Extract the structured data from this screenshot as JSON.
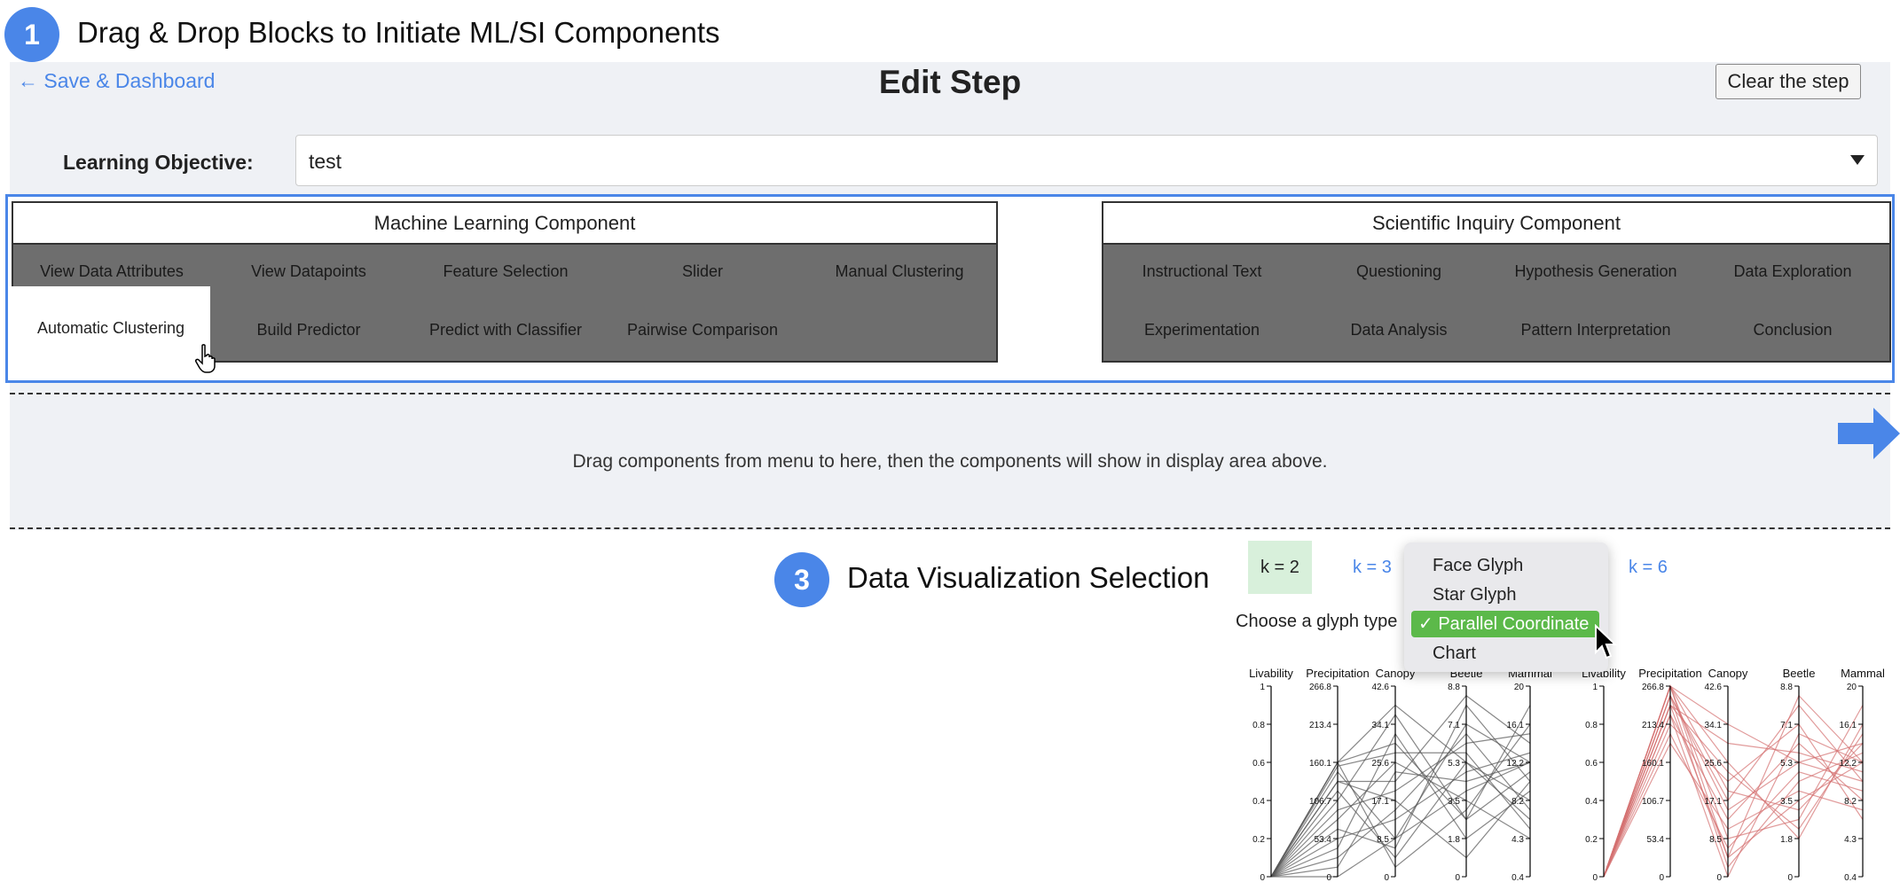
{
  "step1": {
    "number": "1",
    "title": "Drag & Drop Blocks to Initiate ML/SI Components"
  },
  "editor": {
    "back_link": "← Save & Dashboard",
    "title": "Edit Step",
    "clear_button": "Clear the step",
    "objective_label": "Learning Objective:",
    "objective_value": "test"
  },
  "ml_component": {
    "title": "Machine Learning Component",
    "blocks": [
      "View Data Attributes",
      "View Datapoints",
      "Feature Selection",
      "Slider",
      "Manual Clustering",
      "Automatic Clustering",
      "Build Predictor",
      "Predict with Classifier",
      "Pairwise Comparison"
    ],
    "selected": "Automatic Clustering"
  },
  "si_component": {
    "title": "Scientific Inquiry Component",
    "blocks": [
      "Instructional Text",
      "Questioning",
      "Hypothesis Generation",
      "Data Exploration",
      "Experimentation",
      "Data Analysis",
      "Pattern Interpretation",
      "Conclusion"
    ]
  },
  "drop_zone": {
    "text": "Drag components from menu to here, then the components will show in display area above."
  },
  "step3": {
    "number": "3",
    "title": "Data Visualization Selection"
  },
  "visualization": {
    "k_tabs": [
      "k = 2",
      "k = 3",
      "k = 6"
    ],
    "active_k": "k = 2",
    "glyph_label": "Choose a glyph type",
    "glyph_options": [
      "Face Glyph",
      "Star Glyph",
      "Parallel Coordinate",
      "Chart"
    ],
    "selected_glyph": "Parallel Coordinate",
    "check_mark": "✓",
    "colors": {
      "accent": "#4a86e8",
      "selected_green": "#5cb94a",
      "cluster1": "#555555",
      "cluster2": "#d47070"
    }
  },
  "chart_data": [
    {
      "type": "parallel",
      "axes": [
        "Livability",
        "Precipitation",
        "Canopy",
        "Beetle",
        "Mammal"
      ],
      "ticks": [
        [
          "1",
          "0.8",
          "0.6",
          "0.4",
          "0.2",
          "0"
        ],
        [
          "266.8",
          "213.4",
          "160.1",
          "106.7",
          "53.4",
          "0"
        ],
        [
          "42.6",
          "34.1",
          "25.6",
          "17.1",
          "8.5",
          "0"
        ],
        [
          "8.8",
          "7.1",
          "5.3",
          "3.5",
          "1.8",
          "0"
        ],
        [
          "20",
          "16.1",
          "12.2",
          "8.2",
          "4.3",
          "0.4"
        ]
      ],
      "color": "#555555",
      "lines": [
        [
          0,
          0.6,
          0.7,
          0.3,
          0.9
        ],
        [
          0,
          0.55,
          0.2,
          0.8,
          0.6
        ],
        [
          0,
          0.6,
          0.9,
          0.6,
          0.4
        ],
        [
          0,
          0.5,
          0.5,
          0.95,
          0.7
        ],
        [
          0,
          0.45,
          0.1,
          0.6,
          0.3
        ],
        [
          0,
          0.4,
          0.85,
          0.3,
          0.55
        ],
        [
          0,
          0.35,
          0.45,
          0.7,
          0.75
        ],
        [
          0,
          0.3,
          0.6,
          0.4,
          0.2
        ],
        [
          0,
          0.25,
          0.15,
          0.9,
          0.5
        ],
        [
          0,
          0.2,
          0.3,
          0.55,
          0.65
        ],
        [
          0,
          0.15,
          0.75,
          0.2,
          0.45
        ],
        [
          0,
          0.1,
          0.35,
          0.75,
          0.35
        ],
        [
          0,
          0.05,
          0.55,
          0.5,
          0.6
        ],
        [
          0,
          0.6,
          0.05,
          0.35,
          0.8
        ],
        [
          0,
          0.58,
          0.65,
          0.65,
          0.25
        ],
        [
          0,
          0.5,
          0.4,
          0.1,
          0.5
        ],
        [
          0,
          0.0,
          0.2,
          0.45,
          0.6
        ]
      ]
    },
    {
      "type": "parallel",
      "axes": [
        "Livability",
        "Precipitation",
        "Canopy",
        "Beetle",
        "Mammal"
      ],
      "ticks": [
        [
          "1",
          "0.8",
          "0.6",
          "0.4",
          "0.2",
          "0"
        ],
        [
          "266.8",
          "213.4",
          "160.1",
          "106.7",
          "53.4",
          "0"
        ],
        [
          "42.6",
          "34.1",
          "25.6",
          "17.1",
          "8.5",
          "0"
        ],
        [
          "8.8",
          "7.1",
          "5.3",
          "3.5",
          "1.8",
          "0"
        ],
        [
          "20",
          "16.1",
          "12.2",
          "8.2",
          "4.3",
          "0.4"
        ]
      ],
      "color": "#d47070",
      "lines": [
        [
          0,
          1.0,
          0.8,
          0.6,
          0.7
        ],
        [
          0,
          0.95,
          0.4,
          0.9,
          0.5
        ],
        [
          0,
          0.9,
          0.1,
          0.4,
          0.6
        ],
        [
          0,
          1.0,
          0.6,
          0.2,
          0.8
        ],
        [
          0,
          0.85,
          0.3,
          0.7,
          0.4
        ],
        [
          0,
          0.95,
          0.05,
          0.5,
          0.65
        ],
        [
          0,
          0.8,
          0.5,
          0.8,
          0.3
        ],
        [
          0,
          1.0,
          0.2,
          0.3,
          0.9
        ],
        [
          0,
          0.9,
          0.7,
          0.65,
          0.55
        ],
        [
          0,
          0.75,
          0.15,
          0.55,
          0.45
        ],
        [
          0,
          1.0,
          0.45,
          0.35,
          0.7
        ],
        [
          0,
          0.85,
          0.0,
          0.75,
          0.6
        ],
        [
          0,
          0.95,
          0.35,
          0.6,
          0.5
        ],
        [
          0,
          0.7,
          0.25,
          0.45,
          0.35
        ],
        [
          0,
          1.0,
          0.1,
          0.95,
          0.6
        ],
        [
          0,
          0.9,
          0.55,
          0.25,
          0.75
        ]
      ]
    }
  ]
}
